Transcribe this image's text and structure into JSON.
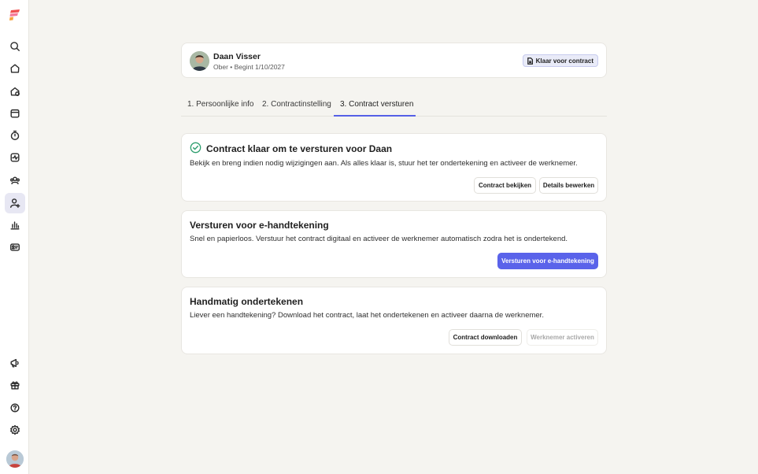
{
  "colors": {
    "accent": "#5a63ea",
    "success": "#2e9e6e",
    "background": "#f5f4f0",
    "logo_red": "#ef4f4f",
    "logo_pink": "#f57a9a",
    "logo_orange": "#f6a23c"
  },
  "sidebar": {
    "items": [
      {
        "icon": "search-icon"
      },
      {
        "icon": "home-icon"
      },
      {
        "icon": "timeline-icon"
      },
      {
        "icon": "calendar-icon"
      },
      {
        "icon": "clock-icon"
      },
      {
        "icon": "activity-icon"
      },
      {
        "icon": "team-icon"
      },
      {
        "icon": "user-add-icon",
        "active": true
      },
      {
        "icon": "chart-icon"
      },
      {
        "icon": "id-card-icon"
      }
    ],
    "bottom_items": [
      {
        "icon": "megaphone-icon"
      },
      {
        "icon": "gift-icon"
      },
      {
        "icon": "help-icon"
      },
      {
        "icon": "settings-icon"
      }
    ]
  },
  "employee": {
    "name": "Daan Visser",
    "subtitle": "Ober • Begint 1/10/2027",
    "status_badge": "Klaar voor contract"
  },
  "tabs": [
    {
      "label": "1. Persoonlijke info"
    },
    {
      "label": "2. Contractinstelling"
    },
    {
      "label": "3. Contract versturen",
      "active": true
    }
  ],
  "ready_card": {
    "title": "Contract klaar om te versturen voor Daan",
    "description": "Bekijk en breng indien nodig wijzigingen aan. Als alles klaar is, stuur het ter ondertekening en activeer de werknemer.",
    "view_button": "Contract bekijken",
    "edit_button": "Details bewerken"
  },
  "esign_card": {
    "title": "Versturen voor e-handtekening",
    "description": "Snel en papierloos. Verstuur het contract digitaal en activeer de werknemer automatisch zodra het is ondertekend.",
    "send_button": "Versturen voor e-handtekening"
  },
  "manual_card": {
    "title": "Handmatig ondertekenen",
    "description": "Liever een handtekening? Download het contract, laat het ondertekenen en activeer daarna de werknemer.",
    "download_button": "Contract downloaden",
    "activate_button": "Werknemer activeren"
  }
}
